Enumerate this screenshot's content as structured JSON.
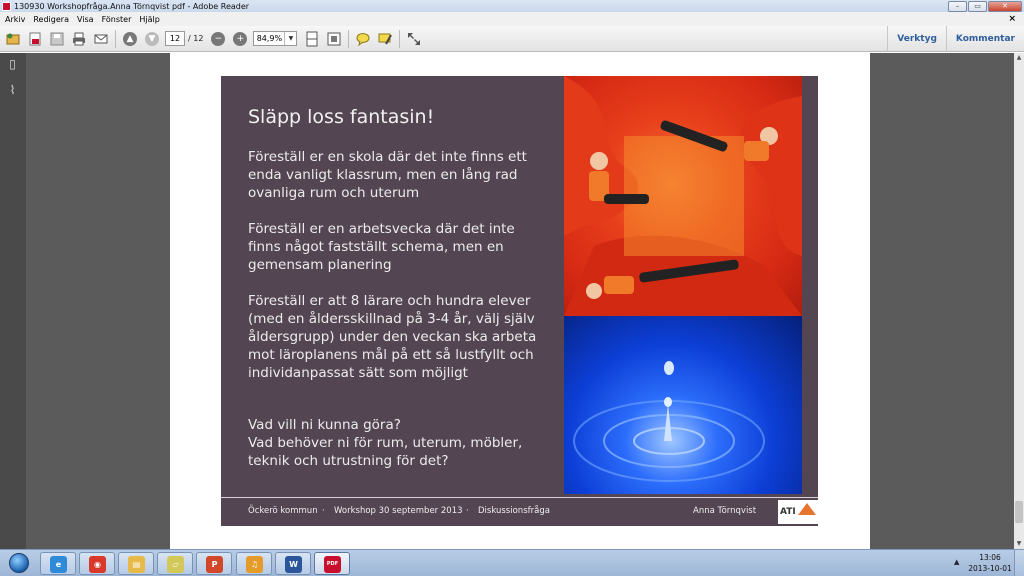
{
  "window": {
    "title": "130930 Workshopfråga.Anna Törnqvist pdf - Adobe Reader",
    "controls": {
      "minimize": "–",
      "maximize": "▭",
      "close": "✕"
    }
  },
  "menu": {
    "items": [
      "Arkiv",
      "Redigera",
      "Visa",
      "Fönster",
      "Hjälp"
    ],
    "doc_close": "×"
  },
  "toolbar": {
    "page_current": "12",
    "page_total": "/ 12",
    "zoom": "84,9%",
    "tools_label": "Verktyg",
    "comment_label": "Kommentar"
  },
  "slide": {
    "title": "Släpp loss fantasin!",
    "paragraphs": [
      "Föreställ er en skola där det inte finns ett enda vanligt klassrum, men en lång rad ovanliga rum och uterum",
      "Föreställ er en arbetsvecka där det inte finns något fastställt schema, men en gemensam planering",
      "Föreställ er att 8 lärare och hundra elever (med en åldersskillnad på 3-4 år, välj själv åldersgrupp) under den veckan ska arbeta mot läroplanens mål på ett så lustfyllt och individanpassat sätt som möjligt",
      "Vad vill ni kunna göra?\nVad behöver ni för rum, uterum, möbler, teknik och utrustning för det?"
    ],
    "footer": {
      "organization": "Öckerö kommun",
      "sep": "·",
      "event": "Workshop 30 september 2013",
      "doc_type": "Diskussionsfråga",
      "author": "Anna Törnqvist",
      "logo_text": "ATI"
    }
  },
  "taskbar": {
    "time": "13:06",
    "date": "2013-10-01",
    "tray_arrow": "▲",
    "apps": [
      {
        "icon": "internet-explorer-icon",
        "glyph": "e",
        "color": "#2f8bd8"
      },
      {
        "icon": "chrome-icon",
        "glyph": "◉",
        "color": "#d9392b"
      },
      {
        "icon": "file-explorer-icon",
        "glyph": "▤",
        "color": "#e7b949"
      },
      {
        "icon": "sticky-folder-icon",
        "glyph": "▱",
        "color": "#d2c85a"
      },
      {
        "icon": "presentation-icon",
        "glyph": "P",
        "color": "#d2472a"
      },
      {
        "icon": "media-app-icon",
        "glyph": "♫",
        "color": "#e59b2a"
      },
      {
        "icon": "word-icon",
        "glyph": "W",
        "color": "#2b579a"
      },
      {
        "icon": "pdf-reader-icon",
        "glyph": "PDF",
        "color": "#c8102e"
      }
    ]
  }
}
